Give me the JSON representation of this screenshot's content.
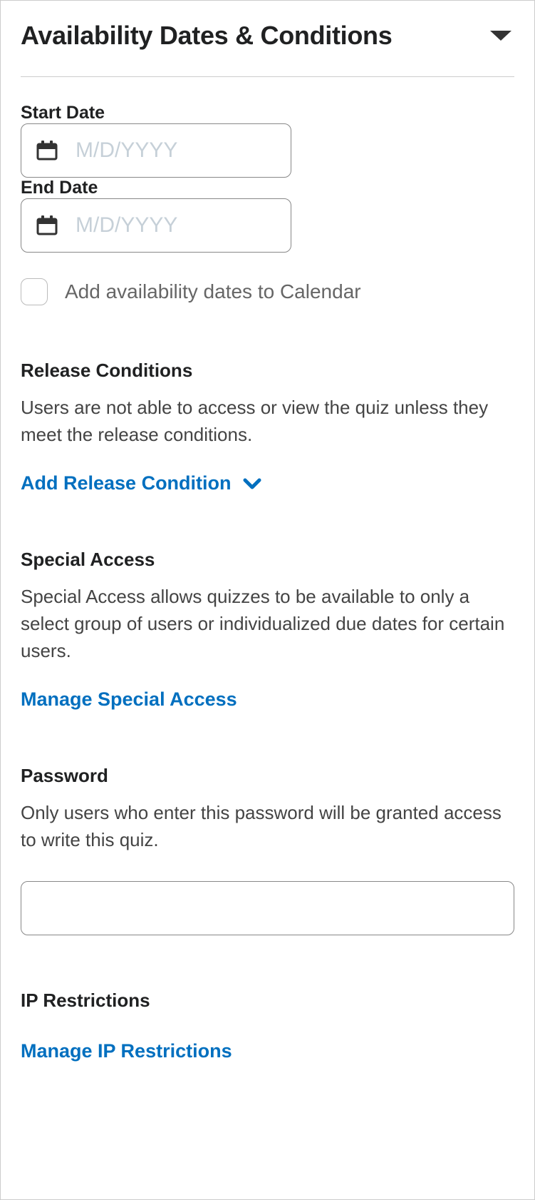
{
  "header": {
    "title": "Availability Dates & Conditions"
  },
  "dates": {
    "start_label": "Start Date",
    "start_placeholder": "M/D/YYYY",
    "start_value": "",
    "end_label": "End Date",
    "end_placeholder": "M/D/YYYY",
    "end_value": "",
    "add_to_calendar_label": "Add availability dates to Calendar",
    "add_to_calendar_checked": false
  },
  "release": {
    "heading": "Release Conditions",
    "description": "Users are not able to access or view the quiz unless they meet the release conditions.",
    "action_label": "Add Release Condition"
  },
  "special_access": {
    "heading": "Special Access",
    "description": "Special Access allows quizzes to be available to only a select group of users or individualized due dates for certain users.",
    "action_label": "Manage Special Access"
  },
  "password": {
    "heading": "Password",
    "description": "Only users who enter this password will be granted access to write this quiz.",
    "value": ""
  },
  "ip": {
    "heading": "IP Restrictions",
    "action_label": "Manage IP Restrictions"
  }
}
